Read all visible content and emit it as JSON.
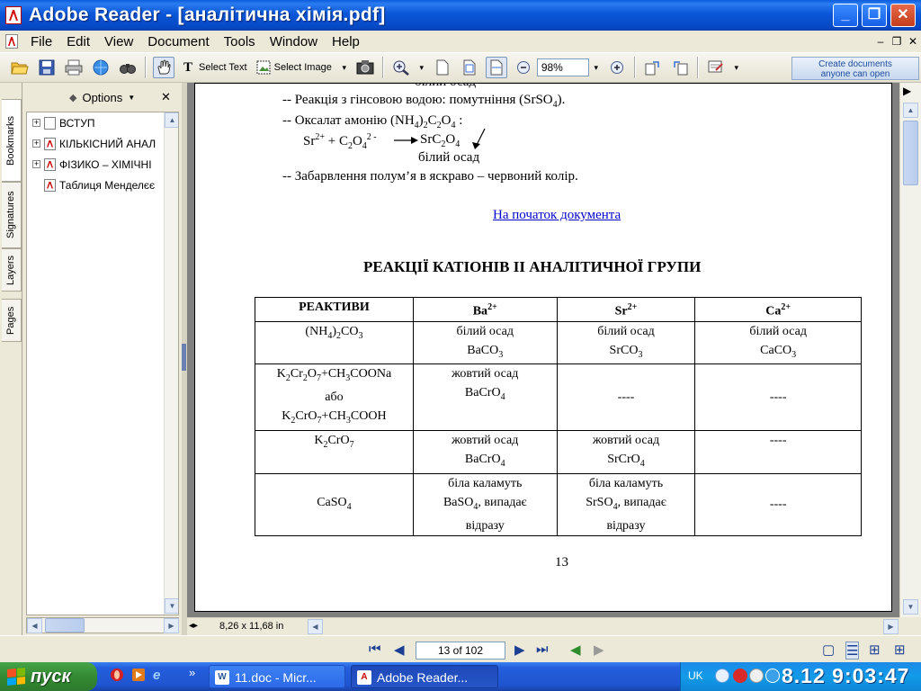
{
  "window": {
    "title": "Adobe Reader - [аналітична хімія.pdf]",
    "min_glyph": "_",
    "max_glyph": "❐",
    "close_glyph": "✕"
  },
  "menu": {
    "items": [
      "File",
      "Edit",
      "View",
      "Document",
      "Tools",
      "Window",
      "Help"
    ],
    "doc_min": "–",
    "doc_restore": "❐",
    "doc_close": "✕"
  },
  "toolbar": {
    "select_text_label": "Select Text",
    "select_image_label": "Select Image",
    "zoom_value": "98%",
    "promo_line1": "Create documents",
    "promo_line2": "anyone can open"
  },
  "nav_tabs": [
    "Bookmarks",
    "Signatures",
    "Layers",
    "Pages"
  ],
  "bookmarks": {
    "options_label": "Options",
    "close_glyph": "✕",
    "items": [
      {
        "label": "ВСТУП",
        "expand": "+",
        "icon": "page-icon"
      },
      {
        "label": "КІЛЬКІСНИЙ АНАЛ",
        "expand": "+",
        "icon": "pdf-page-icon"
      },
      {
        "label": "ФІЗИКО – ХІМІЧНІ",
        "expand": "+",
        "icon": "pdf-page-icon"
      },
      {
        "label": "Таблиця Менделєє",
        "expand": "",
        "icon": "pdf-page-icon"
      }
    ]
  },
  "document": {
    "top_partial": "білий осад",
    "line1_prefix": "-- ",
    "line1_text": "Реакція з гінсовою водою: помутніння (SrSO",
    "line1_sub": "4",
    "line1_suffix": ").",
    "line2_prefix": "-- ",
    "line2_text": "Оксалат амонію (NH",
    "line2_sub1": "4",
    "line2_mid": ")",
    "line2_sub2": "2",
    "line2_c": "C",
    "line2_sub3": "2",
    "line2_o": "O",
    "line2_sub4": "4",
    "line2_end": " :",
    "eq_sr": "Sr",
    "eq_sup": "2+",
    "eq_plus": " + C",
    "eq_sub1": "2",
    "eq_o": "O",
    "eq_sub2": "4",
    "eq_sup2": "2 -",
    "eq_product": "SrC",
    "eq_psub1": "2",
    "eq_po": "O",
    "eq_psub2": "4",
    "eq_precipitate": "білий осад",
    "line3_prefix": "-- ",
    "line3_text": "Забарвлення полум’я в яскраво – червоний колір.",
    "link_text": "На початок документа",
    "heading": "РЕАКЦІЇ КАТІОНІВ ІІ АНАЛІТИЧНОЇ ГРУПИ",
    "page_number": "13"
  },
  "table": {
    "headers": {
      "reagents": "РЕАКТИВИ",
      "ba": "Ba",
      "sr": "Sr",
      "ca": "Ca",
      "charge": "2+"
    },
    "rows": [
      {
        "reagent": "(NH4)2CO3",
        "ba": [
          "білий осад",
          "BaCO3"
        ],
        "sr": [
          "білий осад",
          "SrCO3"
        ],
        "ca": [
          "білий осад",
          "CaCO3"
        ]
      },
      {
        "reagent": [
          "K2Cr2O7+CH3COONa",
          "або",
          "K2CrO7+CH3COOH"
        ],
        "ba": [
          "жовтий осад",
          "BaCrO4"
        ],
        "sr": "----",
        "ca": "----"
      },
      {
        "reagent": "K2CrO7",
        "ba": [
          "жовтий осад",
          "BaCrO4"
        ],
        "sr": [
          "жовтий осад",
          "SrCrO4"
        ],
        "ca": "----"
      },
      {
        "reagent": "CaSO4",
        "ba": [
          "біла каламуть",
          "BaSO4, випадає",
          "відразу"
        ],
        "sr": [
          "біла каламуть",
          "SrSO4, випадає",
          "відразу"
        ],
        "ca": "----"
      }
    ]
  },
  "status": {
    "page_size": "8,26 x 11,68 in",
    "page_indicator": "13 of 102"
  },
  "taskbar": {
    "start_label": "пуск",
    "tasks": [
      "11.doc - Micr...",
      "Adobe Reader..."
    ],
    "chevron": "»",
    "lang": "UK",
    "clock": "8.12 9:03:47"
  }
}
